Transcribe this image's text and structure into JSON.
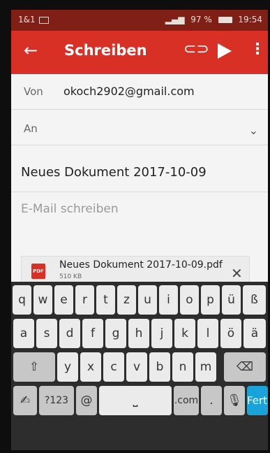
{
  "status": {
    "carrier": "1&1",
    "battery": "97 %",
    "time": "19:54"
  },
  "appbar": {
    "title": "Schreiben"
  },
  "from": {
    "label": "Von",
    "value": "okoch2902@gmail.com"
  },
  "to": {
    "label": "An",
    "value": ""
  },
  "subject": {
    "value": "Neues Dokument 2017-10-09"
  },
  "body": {
    "placeholder": "E-Mail schreiben"
  },
  "attachment": {
    "name": "Neues Dokument 2017-10-09.pdf",
    "size": "510 KB",
    "badge": "PDF"
  },
  "keyboard": {
    "row1": [
      "q",
      "w",
      "e",
      "r",
      "t",
      "z",
      "u",
      "i",
      "o",
      "p",
      "ü",
      "ß"
    ],
    "row2": [
      "a",
      "s",
      "d",
      "f",
      "g",
      "h",
      "j",
      "k",
      "l",
      "ö",
      "ä"
    ],
    "row3": [
      "y",
      "x",
      "c",
      "v",
      "b",
      "n",
      "m"
    ],
    "numbers_label": "?123",
    "at_label": "@",
    "com_label": ".com",
    "dot_label": ".",
    "done_label": "Fertig"
  },
  "colors": {
    "accent": "#d93025",
    "done": "#1aa3d9"
  }
}
